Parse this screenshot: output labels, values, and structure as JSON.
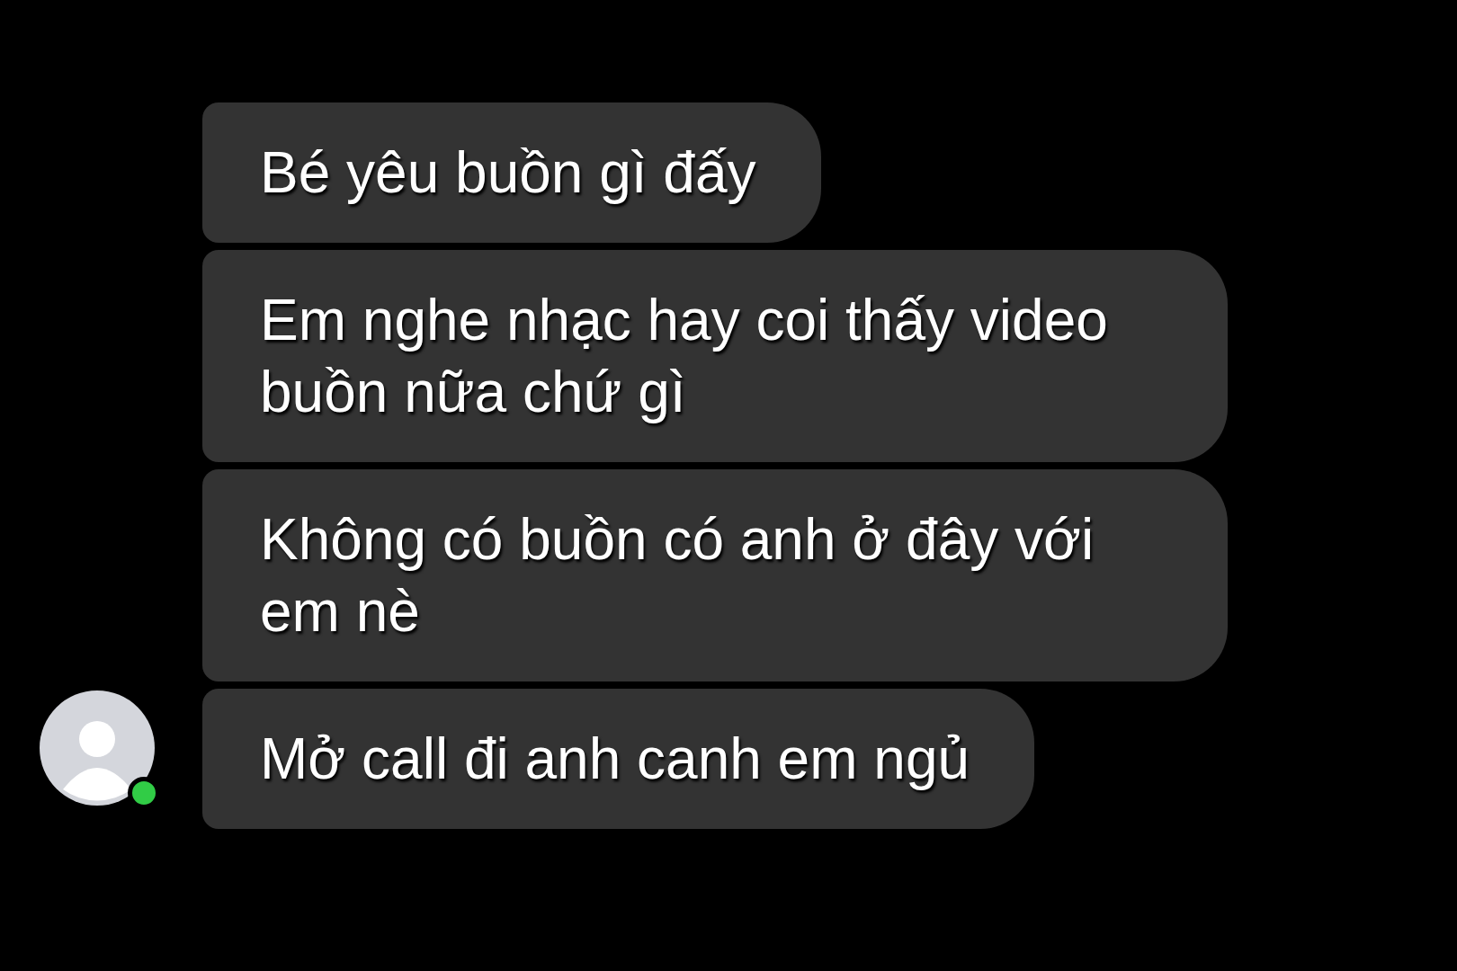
{
  "messages": [
    {
      "text": "Bé yêu buồn gì đấy"
    },
    {
      "text": "Em nghe nhạc hay coi thấy video buồn nữa chứ gì"
    },
    {
      "text": "Không có buồn có anh ở đây với em nè"
    },
    {
      "text": "Mở call đi anh canh em ngủ"
    }
  ],
  "contact": {
    "online": true
  }
}
